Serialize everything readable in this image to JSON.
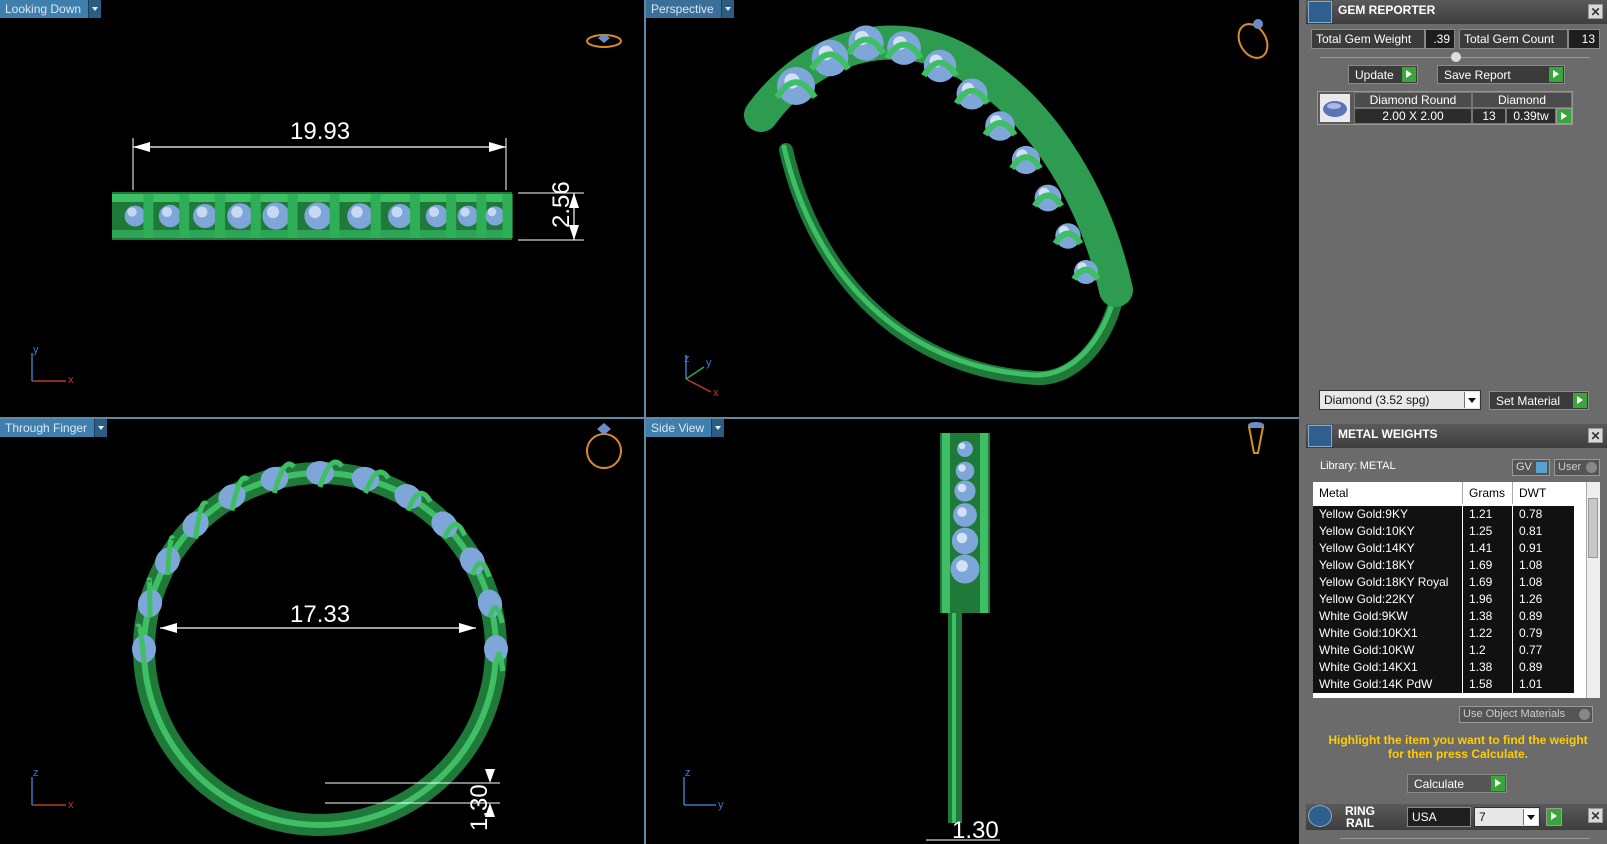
{
  "viewports": {
    "top_left": {
      "label": "Looking Down",
      "dimension": "19.93",
      "height_dimension": "2.56",
      "axis_x": "x",
      "axis_y": "y"
    },
    "top_right": {
      "label": "Perspective",
      "axis_z": "z",
      "axis_y": "y",
      "axis_x": "x"
    },
    "bottom_left": {
      "label": "Through Finger",
      "dimension": "17.33",
      "thickness_dimension": "1.30",
      "axis_z": "z",
      "axis_x": "x"
    },
    "bottom_right": {
      "label": "Side View",
      "thickness_dimension": "1.30",
      "axis_z": "z",
      "axis_y": "y"
    }
  },
  "gem_reporter": {
    "title": "GEM REPORTER",
    "total_weight_label": "Total Gem Weight",
    "total_weight_value": ".39",
    "total_count_label": "Total Gem Count",
    "total_count_value": "13",
    "update_label": "Update",
    "save_report_label": "Save Report",
    "gem": {
      "shape": "Diamond Round",
      "material": "Diamond",
      "size": "2.00 X 2.00",
      "count": "13",
      "weight": "0.39tw"
    },
    "material_select": "Diamond    (3.52 spg)",
    "set_material_label": "Set Material",
    "close": "✕"
  },
  "metal_weights": {
    "title": "METAL WEIGHTS",
    "library_label": "Library: METAL",
    "gv_label": "GV",
    "user_label": "User",
    "columns": [
      "Metal",
      "Grams",
      "DWT"
    ],
    "rows": [
      [
        "Yellow Gold:9KY",
        "1.21",
        "0.78"
      ],
      [
        "Yellow Gold:10KY",
        "1.25",
        "0.81"
      ],
      [
        "Yellow Gold:14KY",
        "1.41",
        "0.91"
      ],
      [
        "Yellow Gold:18KY",
        "1.69",
        "1.08"
      ],
      [
        "Yellow Gold:18KY Royal",
        "1.69",
        "1.08"
      ],
      [
        "Yellow Gold:22KY",
        "1.96",
        "1.26"
      ],
      [
        "White Gold:9KW",
        "1.38",
        "0.89"
      ],
      [
        "White Gold:10KX1",
        "1.22",
        "0.79"
      ],
      [
        "White Gold:10KW",
        "1.2",
        "0.77"
      ],
      [
        "White Gold:14KX1",
        "1.38",
        "0.89"
      ],
      [
        "White Gold:14K PdW",
        "1.58",
        "1.01"
      ]
    ],
    "use_object_materials": "Use Object Materials",
    "hint": "Highlight the item you want to find the weight for then press Calculate.",
    "calculate_label": "Calculate",
    "close": "✕"
  },
  "ring_rail": {
    "title": "RING RAIL",
    "country": "USA",
    "size": "7",
    "close": "✕"
  },
  "colors": {
    "metal": "#2f9a4e",
    "gem": "#7fa6d8",
    "viewport_bg": "#000000",
    "label_bg": "#3f7fae"
  }
}
